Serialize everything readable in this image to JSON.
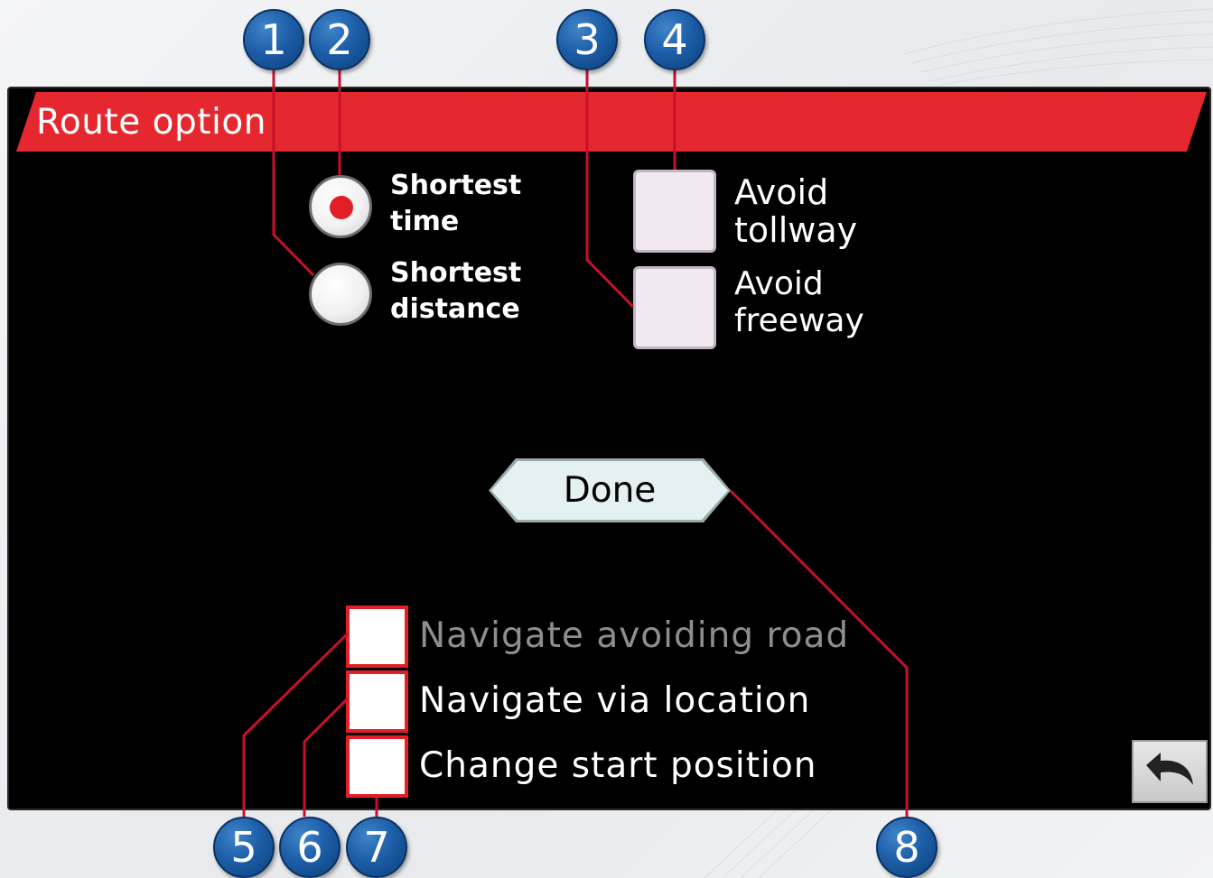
{
  "title": "Route option",
  "route_mode": {
    "options": [
      {
        "label_line1": "Shortest",
        "label_line2": "time",
        "selected": true
      },
      {
        "label_line1": "Shortest",
        "label_line2": "distance",
        "selected": false
      }
    ]
  },
  "avoid": {
    "tollway": {
      "line1": "Avoid",
      "line2": "tollway",
      "checked": false
    },
    "freeway": {
      "line1": "Avoid",
      "line2": "freeway",
      "checked": false
    }
  },
  "done_label": "Done",
  "route_actions": [
    {
      "label": "Navigate avoiding road",
      "enabled": false
    },
    {
      "label": "Navigate via location",
      "enabled": true
    },
    {
      "label": "Change start position",
      "enabled": true
    }
  ],
  "back_icon": "undo-arrow-icon",
  "callouts": [
    "1",
    "2",
    "3",
    "4",
    "5",
    "6",
    "7",
    "8"
  ],
  "colors": {
    "accent_red": "#e5282f",
    "callout_blue": "#1d5ea8",
    "screen_bg": "#000000",
    "disabled_text": "#8e8e8e"
  }
}
